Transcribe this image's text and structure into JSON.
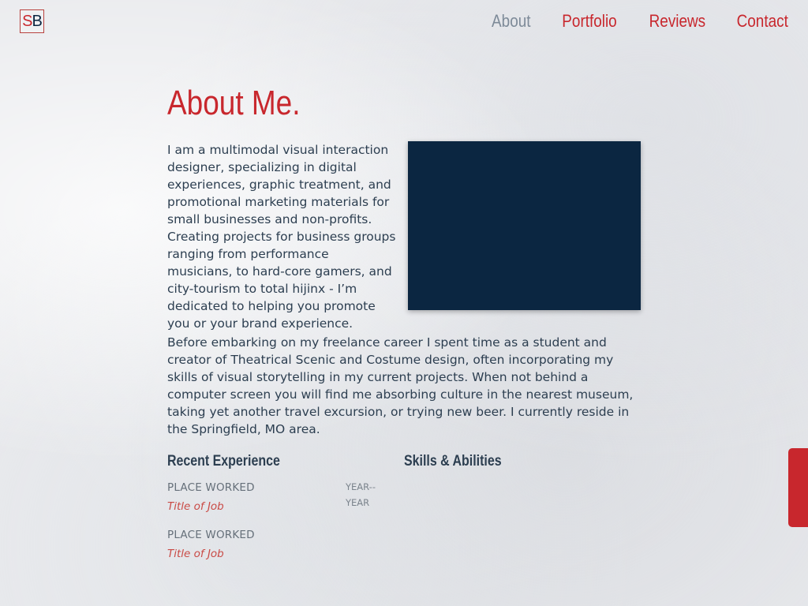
{
  "logo": {
    "letter_1": "S",
    "letter_2": "B"
  },
  "nav": {
    "items": [
      {
        "label": "About",
        "active": true
      },
      {
        "label": "Portfolio",
        "active": false
      },
      {
        "label": "Reviews",
        "active": false
      },
      {
        "label": "Contact",
        "active": false
      }
    ]
  },
  "about": {
    "title": "About Me.",
    "intro": "I am a multimodal visual interaction designer, specializing in digital experiences, graphic treatment, and promotional marketing materials for small businesses and non-profits. Creating projects for business groups ranging from performance musicians, to hard-core gamers, and city-tourism to total hijinx - I’m dedicated to helping you promote you or your brand experience.",
    "bio": "Before embarking on my freelance career I spent time as a student and creator of Theatrical Scenic and Costume design, often incorporating my skills of visual storytelling in my current projects. When not behind a computer screen you will find me absorbing culture in the nearest museum, taking yet another travel excursion, or trying new beer. I currently reside in the Springfield, MO area."
  },
  "experience": {
    "heading": "Recent Experience",
    "items": [
      {
        "place": "PLACE WORKED",
        "title": "Title of Job",
        "years": "YEAR--YEAR"
      },
      {
        "place": "PLACE WORKED",
        "title": "Title of Job",
        "years": ""
      }
    ]
  },
  "skills": {
    "heading": "Skills & Abilities"
  },
  "colors": {
    "accent": "#c8272d",
    "navy": "#0b2641",
    "text": "#2c3e50",
    "nav_active": "#7d8a98"
  }
}
